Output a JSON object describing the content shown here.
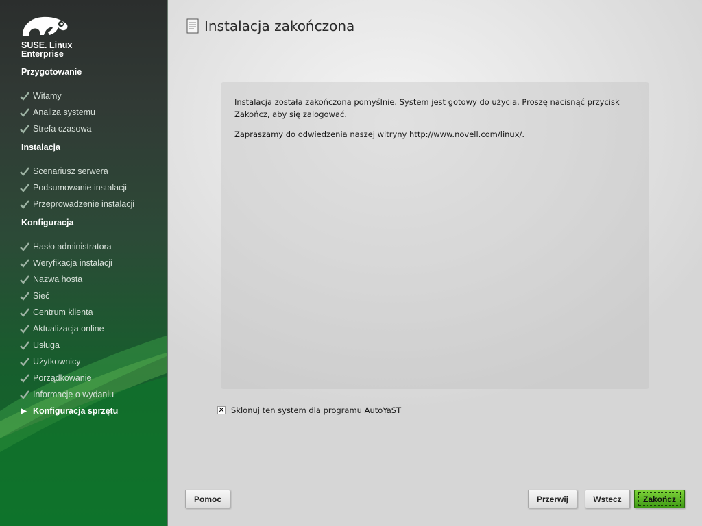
{
  "brand": {
    "line1": "SUSE. Linux",
    "line2": "Enterprise"
  },
  "sidebar": {
    "sections": [
      {
        "title": "Przygotowanie",
        "steps": [
          "Witamy",
          "Analiza systemu",
          "Strefa czasowa"
        ]
      },
      {
        "title": "Instalacja",
        "steps": [
          "Scenariusz serwera",
          "Podsumowanie instalacji",
          "Przeprowadzenie instalacji"
        ]
      },
      {
        "title": "Konfiguracja",
        "steps": [
          "Hasło administratora",
          "Weryfikacja instalacji",
          "Nazwa hosta",
          "Sieć",
          "Centrum klienta",
          "Aktualizacja online",
          "Usługa",
          "Użytkownicy",
          "Porządkowanie",
          "Informacje o wydaniu",
          "Konfiguracja sprzętu"
        ]
      }
    ],
    "current_step": "Konfiguracja sprzętu"
  },
  "page": {
    "title": "Instalacja zakończona",
    "message1": "Instalacja została zakończona pomyślnie. System jest gotowy do użycia. Proszę nacisnąć przycisk Zakończ, aby się zalogować.",
    "message2": "Zapraszamy do odwiedzenia naszej witryny http://www.novell.com/linux/."
  },
  "autoyast": {
    "checked": true,
    "mark": "✕",
    "label": "Sklonuj ten system dla programu AutoYaST"
  },
  "buttons": {
    "help": "Pomoc",
    "abort": "Przerwij",
    "back": "Wstecz",
    "finish": "Zakończ"
  }
}
